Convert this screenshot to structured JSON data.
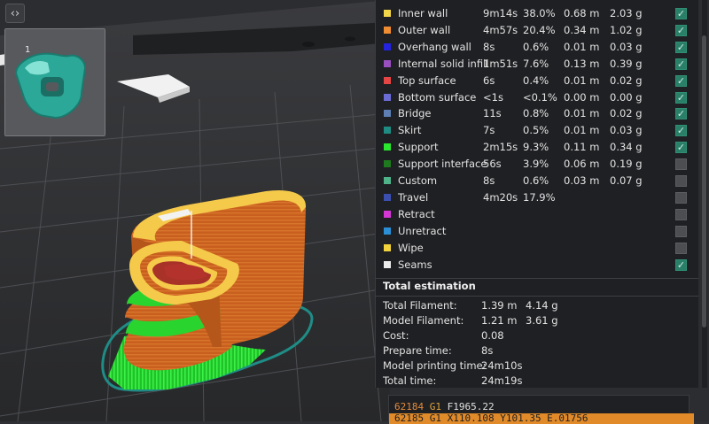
{
  "toolbar": {
    "collapse_icon": "collapse-arrows-icon",
    "collapse_label": "<>"
  },
  "plate": {
    "number": "1"
  },
  "legend": {
    "rows": [
      {
        "name": "Inner wall",
        "color": "#f2d64a",
        "time": "9m14s",
        "percent": "38.0%",
        "length": "0.68 m",
        "weight": "2.03 g",
        "checked": true
      },
      {
        "name": "Outer wall",
        "color": "#f08c32",
        "time": "4m57s",
        "percent": "20.4%",
        "length": "0.34 m",
        "weight": "1.02 g",
        "checked": true
      },
      {
        "name": "Overhang wall",
        "color": "#2323e0",
        "time": "8s",
        "percent": "0.6%",
        "length": "0.01 m",
        "weight": "0.03 g",
        "checked": true
      },
      {
        "name": "Internal solid infill",
        "color": "#9a4fbe",
        "time": "1m51s",
        "percent": "7.6%",
        "length": "0.13 m",
        "weight": "0.39 g",
        "checked": true
      },
      {
        "name": "Top surface",
        "color": "#e64545",
        "time": "6s",
        "percent": "0.4%",
        "length": "0.01 m",
        "weight": "0.02 g",
        "checked": true
      },
      {
        "name": "Bottom surface",
        "color": "#6b6bd6",
        "time": "<1s",
        "percent": "<0.1%",
        "length": "0.00 m",
        "weight": "0.00 g",
        "checked": true
      },
      {
        "name": "Bridge",
        "color": "#5d7fb3",
        "time": "11s",
        "percent": "0.8%",
        "length": "0.01 m",
        "weight": "0.02 g",
        "checked": true
      },
      {
        "name": "Skirt",
        "color": "#1e8c82",
        "time": "7s",
        "percent": "0.5%",
        "length": "0.01 m",
        "weight": "0.03 g",
        "checked": true
      },
      {
        "name": "Support",
        "color": "#29e82f",
        "time": "2m15s",
        "percent": "9.3%",
        "length": "0.11 m",
        "weight": "0.34 g",
        "checked": true
      },
      {
        "name": "Support interface",
        "color": "#1f7a1f",
        "time": "56s",
        "percent": "3.9%",
        "length": "0.06 m",
        "weight": "0.19 g",
        "checked": false
      },
      {
        "name": "Custom",
        "color": "#4fb38a",
        "time": "8s",
        "percent": "0.6%",
        "length": "0.03 m",
        "weight": "0.07 g",
        "checked": false
      },
      {
        "name": "Travel",
        "color": "#3b4fb0",
        "time": "4m20s",
        "percent": "17.9%",
        "length": "",
        "weight": "",
        "checked": false
      },
      {
        "name": "Retract",
        "color": "#d437d6",
        "time": "",
        "percent": "",
        "length": "",
        "weight": "",
        "checked": false
      },
      {
        "name": "Unretract",
        "color": "#2a8fd6",
        "time": "",
        "percent": "",
        "length": "",
        "weight": "",
        "checked": false
      },
      {
        "name": "Wipe",
        "color": "#f2d23a",
        "time": "",
        "percent": "",
        "length": "",
        "weight": "",
        "checked": false
      },
      {
        "name": "Seams",
        "color": "#ececec",
        "time": "",
        "percent": "",
        "length": "",
        "weight": "",
        "checked": true
      }
    ]
  },
  "total": {
    "title": "Total estimation",
    "total_filament_label": "Total Filament:",
    "total_filament_length": "1.39 m",
    "total_filament_weight": "4.14 g",
    "model_filament_label": "Model Filament:",
    "model_filament_length": "1.21 m",
    "model_filament_weight": "3.61 g",
    "cost_label": "Cost:",
    "cost_value": "0.08",
    "prepare_label": "Prepare time:",
    "prepare_value": "8s",
    "model_print_label": "Model printing time:",
    "model_print_value": "24m10s",
    "total_time_label": "Total time:",
    "total_time_value": "24m19s"
  },
  "gcode": {
    "line_number": "62184",
    "command": "G1",
    "args": "F1965.22",
    "next_line": "62185  G1 X110.108 Y101.35 E.01756"
  }
}
